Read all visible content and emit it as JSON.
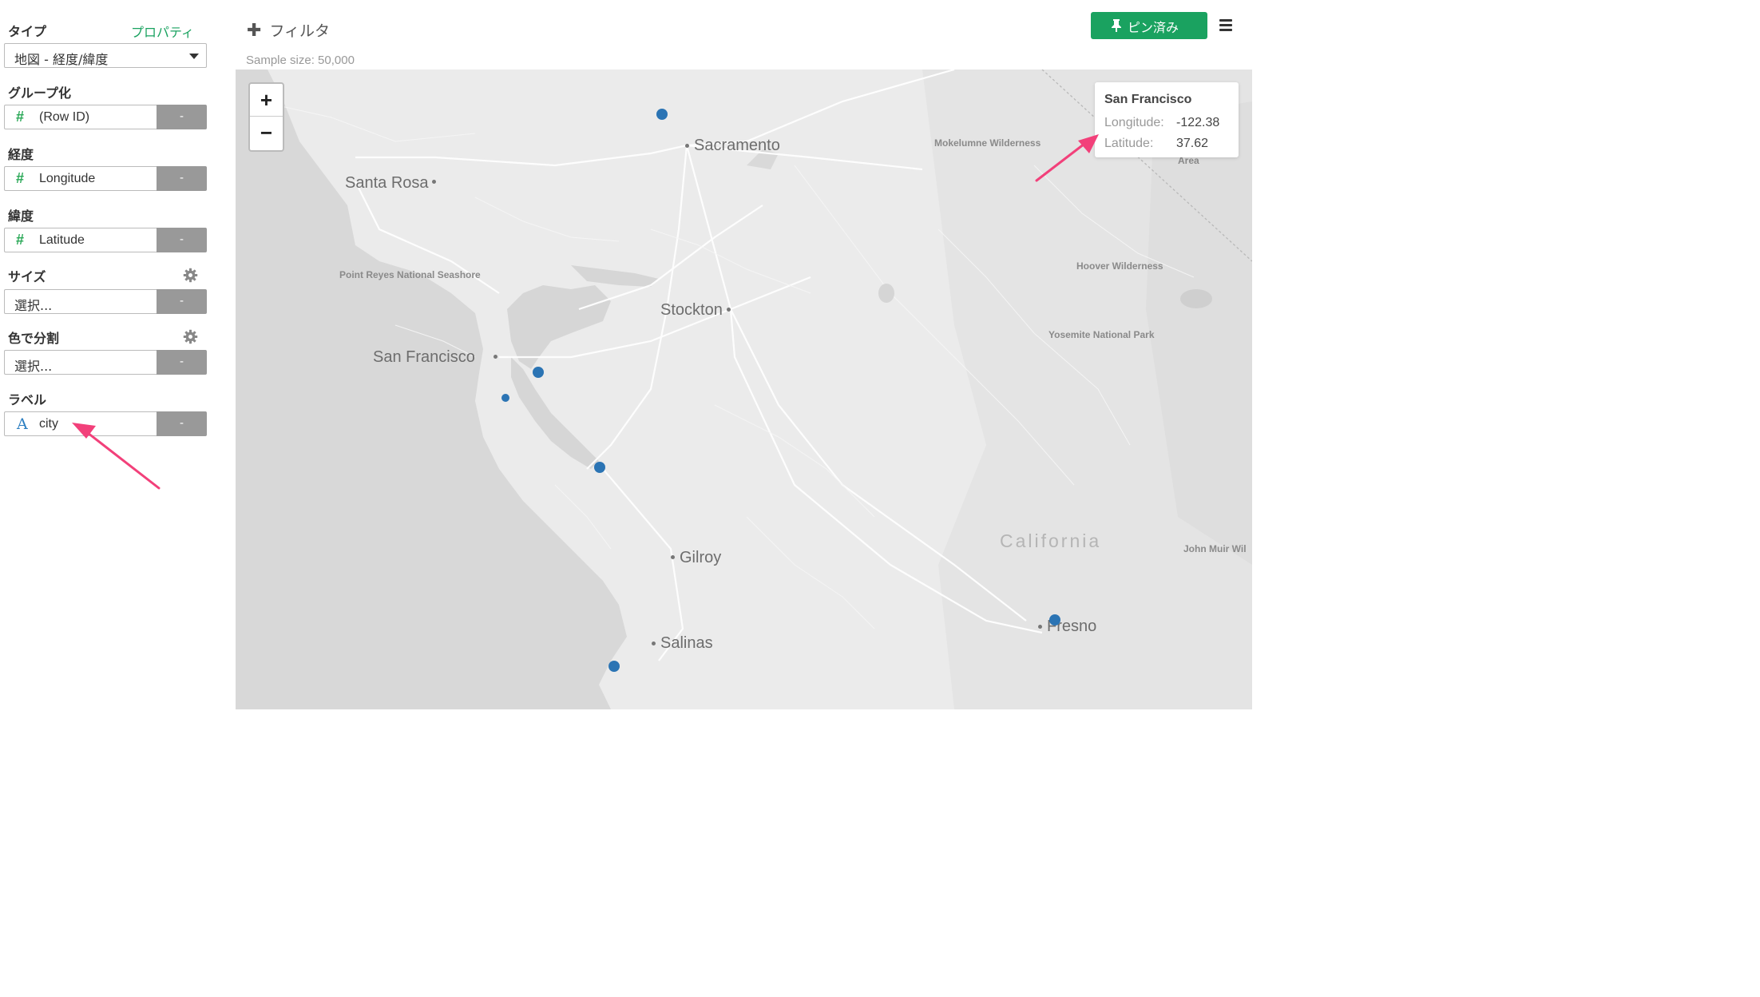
{
  "sidebar": {
    "type_label": "タイプ",
    "property_link": "プロパティ",
    "type_value": "地図 - 経度/緯度",
    "group_label": "グループ化",
    "group_field": "(Row ID)",
    "longitude_label": "経度",
    "longitude_field": "Longitude",
    "latitude_label": "緯度",
    "latitude_field": "Latitude",
    "size_label": "サイズ",
    "size_placeholder": "選択...",
    "color_label": "色で分割",
    "color_placeholder": "選択...",
    "label_label": "ラベル",
    "label_field": "city",
    "remove_label": "-",
    "field_type_number": "#",
    "field_type_text": "A"
  },
  "toolbar": {
    "filter_label": "フィルタ",
    "sample_size": "Sample size: 50,000",
    "pin_label": "ピン済み",
    "accent_color": "#1aa260"
  },
  "map": {
    "zoom_in": "+",
    "zoom_out": "−",
    "places": {
      "sacramento": "Sacramento",
      "santa_rosa": "Santa Rosa",
      "stockton": "Stockton",
      "san_francisco": "San Francisco",
      "gilroy": "Gilroy",
      "salinas": "Salinas",
      "fresno": "Fresno",
      "california": "California",
      "point_reyes": "Point Reyes National Seashore",
      "mokelumne": "Mokelumne Wilderness",
      "hoover": "Hoover Wilderness",
      "yosemite": "Yosemite National Park",
      "john_muir": "John Muir Wil",
      "area": "Area"
    },
    "marker_color": "#2b74b4",
    "tooltip": {
      "title": "San Francisco",
      "longitude_key": "Longitude:",
      "longitude_value": "-122.38",
      "latitude_key": "Latitude:",
      "latitude_value": "37.62"
    }
  }
}
